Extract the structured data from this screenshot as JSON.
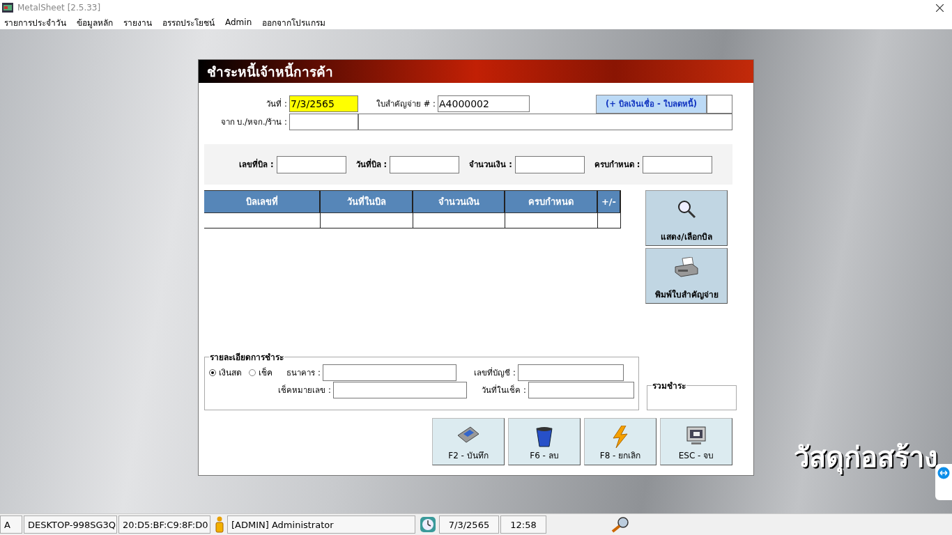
{
  "window": {
    "title": "MetalSheet [2.5.33]"
  },
  "menu": [
    "รายการประจำวัน",
    "ข้อมูลหลัก",
    "รายงาน",
    "อรรถประโยชน์",
    "Admin",
    "ออกจากโปรแกรม"
  ],
  "form": {
    "title": "ชำระหนี้เจ้าหนี้การค้า",
    "date_label": "วันที่ :",
    "date_value": "7/3/2565",
    "voucher_label": "ใบสำคัญจ่าย # :",
    "voucher_value": "A4000002",
    "credit_button": "(+ บิลเงินเชื่อ - ใบลดหนี้)",
    "from_label": "จาก บ./หจก./ร้าน :",
    "filter_fields": [
      "เลขที่บิล :",
      "วันที่บิล :",
      "จำนวนเงิน :",
      "ครบกำหนด :"
    ],
    "table": {
      "columns": [
        "บิลเลขที่",
        "วันที่ในบิล",
        "จำนวนเงิน",
        "ครบกำหนด",
        "+/-"
      ]
    },
    "side_buttons": [
      {
        "label": "แสดง/เลือกบิล",
        "kind": "search"
      },
      {
        "label": "พิมพ์ใบสำคัญจ่าย",
        "kind": "print"
      }
    ],
    "payment": {
      "legend": "รายละเอียดการชำระ",
      "options": [
        {
          "label": "เงินสด",
          "selected": true
        },
        {
          "label": "เช็ค",
          "selected": false
        }
      ],
      "bank_label": "ธนาคาร :",
      "account_label": "เลขที่บัญชี :",
      "cheque_no_label": "เช็คหมายเลข :",
      "cheque_date_label": "วันที่ในเช็ค :"
    },
    "total_legend": "รวมชำระ",
    "actions": [
      {
        "label": "F2 - บันทึก",
        "kind": "save"
      },
      {
        "label": "F6 - ลบ",
        "kind": "delete"
      },
      {
        "label": "F8 - ยกเลิก",
        "kind": "cancel"
      },
      {
        "label": "ESC - จบ",
        "kind": "exit"
      }
    ]
  },
  "banner": "วัสดุก่อสร้าง",
  "status_bar": [
    {
      "text": "A",
      "kind": "text"
    },
    {
      "text": "DESKTOP-998SG3Q",
      "kind": "text"
    },
    {
      "text": "20:D5:BF:C9:8F:D0",
      "kind": "text"
    },
    {
      "text": "[ADMIN] Administrator",
      "kind": "user"
    },
    {
      "text": "7/3/2565",
      "kind": "date"
    },
    {
      "text": "12:58",
      "kind": "text"
    }
  ]
}
